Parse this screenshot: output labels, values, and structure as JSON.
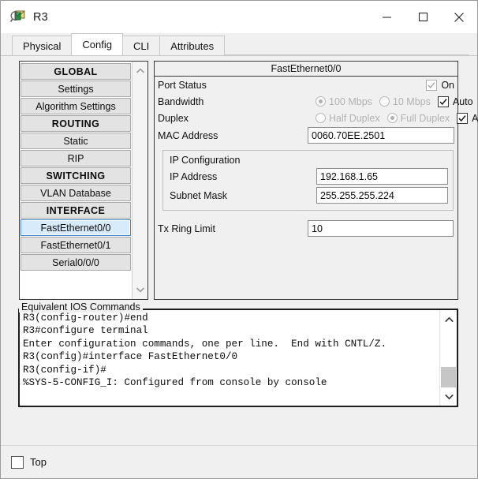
{
  "window": {
    "title": "R3",
    "icon": "router-magnifier-icon",
    "controls": {
      "minimize": "minimize-icon",
      "maximize": "maximize-icon",
      "close": "close-icon"
    }
  },
  "tabs": [
    {
      "label": "Physical",
      "active": false
    },
    {
      "label": "Config",
      "active": true
    },
    {
      "label": "CLI",
      "active": false
    },
    {
      "label": "Attributes",
      "active": false
    }
  ],
  "sidebar": {
    "items": [
      {
        "label": "GLOBAL",
        "type": "header"
      },
      {
        "label": "Settings",
        "type": "item"
      },
      {
        "label": "Algorithm Settings",
        "type": "item"
      },
      {
        "label": "ROUTING",
        "type": "header"
      },
      {
        "label": "Static",
        "type": "item"
      },
      {
        "label": "RIP",
        "type": "item"
      },
      {
        "label": "SWITCHING",
        "type": "header"
      },
      {
        "label": "VLAN Database",
        "type": "item"
      },
      {
        "label": "INTERFACE",
        "type": "header"
      },
      {
        "label": "FastEthernet0/0",
        "type": "item",
        "selected": true
      },
      {
        "label": "FastEthernet0/1",
        "type": "item"
      },
      {
        "label": "Serial0/0/0",
        "type": "item"
      }
    ],
    "scroll_up": "chevron-up-icon",
    "scroll_down": "chevron-down-icon"
  },
  "config": {
    "panel_title": "FastEthernet0/0",
    "port_status": {
      "label": "Port Status",
      "checkbox_label": "On",
      "checked": true,
      "enabled": false
    },
    "bandwidth": {
      "label": "Bandwidth",
      "options": [
        {
          "label": "100 Mbps",
          "selected": true
        },
        {
          "label": "10 Mbps",
          "selected": false
        }
      ],
      "auto_label": "Auto",
      "auto_checked": true
    },
    "duplex": {
      "label": "Duplex",
      "options": [
        {
          "label": "Half Duplex",
          "selected": false
        },
        {
          "label": "Full Duplex",
          "selected": true
        }
      ],
      "auto_label": "Auto",
      "auto_checked": true
    },
    "mac_address": {
      "label": "MAC Address",
      "value": "0060.70EE.2501"
    },
    "ip_configuration": {
      "legend": "IP Configuration",
      "ip_address": {
        "label": "IP Address",
        "value": "192.168.1.65"
      },
      "subnet_mask": {
        "label": "Subnet Mask",
        "value": "255.255.255.224"
      }
    },
    "tx_ring_limit": {
      "label": "Tx Ring Limit",
      "value": "10"
    }
  },
  "ios_commands": {
    "legend": "Equivalent IOS Commands",
    "text": "R3(config-router)#end\nR3#configure terminal\nEnter configuration commands, one per line.  End with CNTL/Z.\nR3(config)#interface FastEthernet0/0\nR3(config-if)#\n%SYS-5-CONFIG_I: Configured from console by console",
    "scroll_up": "chevron-up-icon",
    "scroll_down": "chevron-down-icon"
  },
  "bottom": {
    "top_checkbox": {
      "label": "Top",
      "checked": false
    }
  },
  "colors": {
    "window_bg": "#f0f0f0",
    "selection_blue": "#d8ebfb",
    "selection_border": "#3d85c6",
    "button_face": "#e3e3e3",
    "disabled_text": "#b2b2b2"
  }
}
